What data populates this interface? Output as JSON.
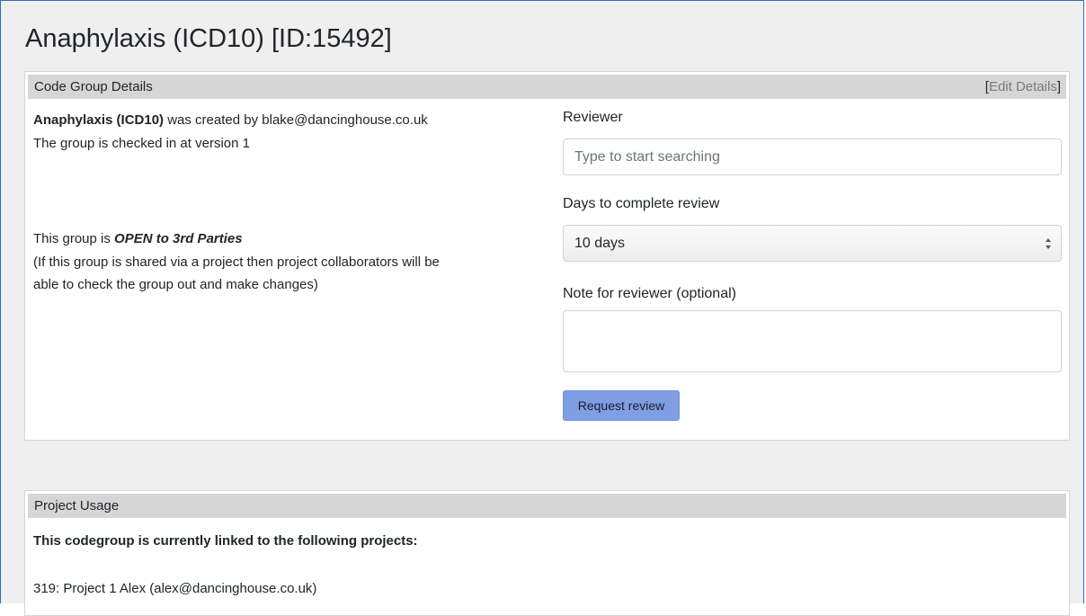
{
  "page": {
    "title": "Anaphylaxis (ICD10) [ID:15492]"
  },
  "code_group_details": {
    "heading": "Code Group Details",
    "edit_open_bracket": "[",
    "edit_link": "Edit Details",
    "edit_close_bracket": "]",
    "group_name": "Anaphylaxis (ICD10)",
    "created_by_text": " was created by blake@dancinghouse.co.uk",
    "version_text": "The group is checked in at version 1",
    "open_prefix": "This group is ",
    "open_status": "OPEN to 3rd Parties",
    "open_note_line1": "(If this group is shared via a project then project collaborators will be",
    "open_note_line2": "able to check the group out and make changes)"
  },
  "review_form": {
    "reviewer_label": "Reviewer",
    "reviewer_placeholder": "Type to start searching",
    "reviewer_value": "",
    "days_label": "Days to complete review",
    "days_selected": "10 days",
    "note_label": "Note for reviewer (optional)",
    "note_value": "",
    "request_button": "Request review"
  },
  "project_usage": {
    "heading": "Project Usage",
    "intro": "This codegroup is currently linked to the following projects:",
    "projects": [
      "319: Project 1 Alex (alex@dancinghouse.co.uk)"
    ]
  }
}
